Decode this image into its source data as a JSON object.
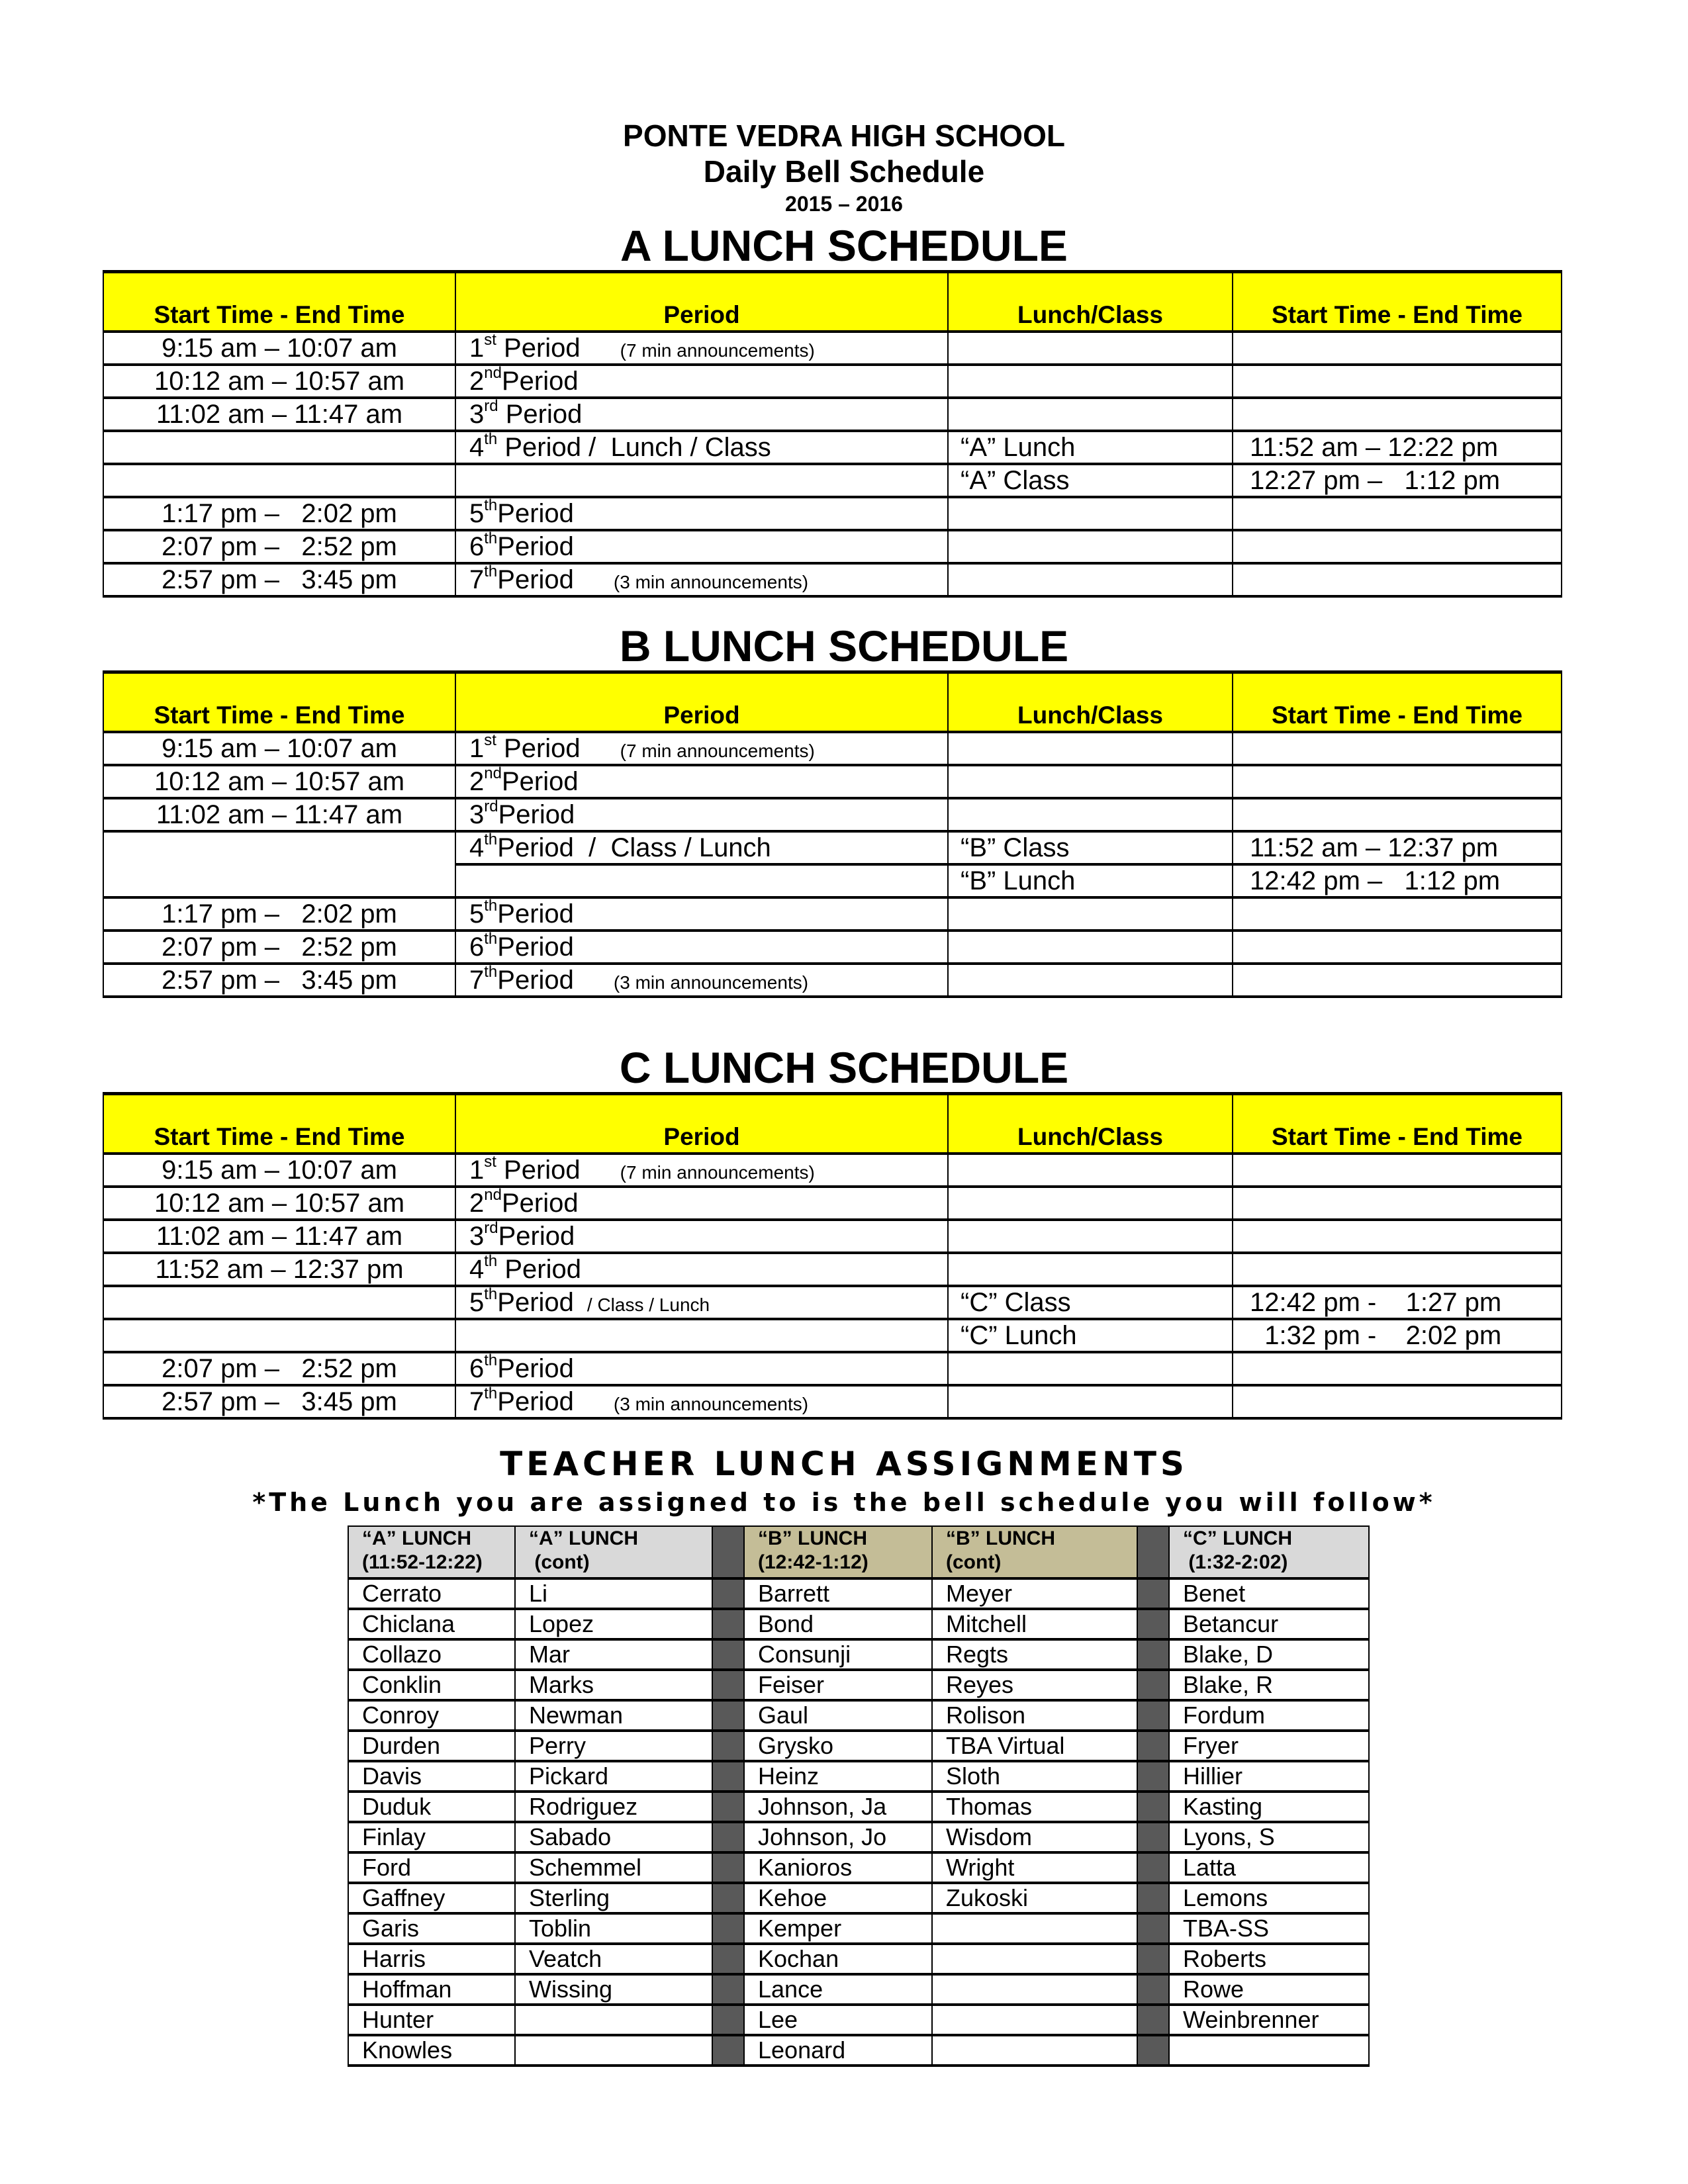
{
  "header": {
    "school": "PONTE VEDRA HIGH SCHOOL",
    "subtitle": "Daily Bell Schedule",
    "year": "2015 – 2016"
  },
  "column_headers": [
    "Start  Time - End Time",
    "Period",
    "Lunch/Class",
    "Start Time - End Time"
  ],
  "schedules": {
    "a": {
      "title": "A LUNCH SCHEDULE",
      "rows": [
        {
          "time": "9:15 am – 10:07 am",
          "num": "1",
          "suf": "st",
          "period": " Period",
          "note": "(7 min announcements)",
          "lc": "",
          "time2": ""
        },
        {
          "time": "10:12 am – 10:57 am",
          "num": "2",
          "suf": "nd",
          "period": "Period",
          "note": "",
          "lc": "",
          "time2": ""
        },
        {
          "time": "11:02 am – 11:47 am",
          "num": "3",
          "suf": "rd",
          "period": " Period",
          "note": "",
          "lc": "",
          "time2": ""
        },
        {
          "time": "",
          "num": "4",
          "suf": "th",
          "period": " Period /  Lunch / Class",
          "note": "",
          "lc": "“A” Lunch",
          "time2": "11:52 am – 12:22 pm"
        },
        {
          "time": "",
          "num": "",
          "suf": "",
          "period": "",
          "note": "",
          "lc": "“A” Class",
          "time2": "12:27 pm –   1:12 pm"
        },
        {
          "time": "1:17 pm –   2:02 pm",
          "num": "5",
          "suf": "th",
          "period": "Period",
          "note": "",
          "lc": "",
          "time2": ""
        },
        {
          "time": "2:07 pm –   2:52 pm",
          "num": "6",
          "suf": "th",
          "period": "Period",
          "note": "",
          "lc": "",
          "time2": ""
        },
        {
          "time": "2:57 pm –   3:45 pm",
          "num": "7",
          "suf": "th",
          "period": "Period",
          "note": "(3 min announcements)",
          "lc": "",
          "time2": ""
        }
      ]
    },
    "b": {
      "title": "B LUNCH SCHEDULE",
      "rows": [
        {
          "time": "9:15 am – 10:07 am",
          "num": "1",
          "suf": "st",
          "period": " Period",
          "note": "(7 min announcements)",
          "lc": "",
          "time2": ""
        },
        {
          "time": "10:12 am – 10:57 am",
          "num": "2",
          "suf": "nd",
          "period": "Period",
          "note": "",
          "lc": "",
          "time2": ""
        },
        {
          "time": "11:02 am – 11:47 am",
          "num": "3",
          "suf": "rd",
          "period": "Period",
          "note": "",
          "lc": "",
          "time2": ""
        },
        {
          "time": "",
          "num": "4",
          "suf": "th",
          "period": "Period  /  Class / Lunch",
          "note": "",
          "lc": "“B” Class",
          "time2": "11:52 am – 12:37 pm"
        },
        {
          "time": "",
          "num": "",
          "suf": "",
          "period": "",
          "note": "",
          "lc": "“B” Lunch",
          "time2": "12:42 pm –   1:12 pm"
        },
        {
          "time": "1:17 pm –   2:02 pm",
          "num": "5",
          "suf": "th",
          "period": "Period",
          "note": "",
          "lc": "",
          "time2": ""
        },
        {
          "time": "2:07 pm –   2:52 pm",
          "num": "6",
          "suf": "th",
          "period": "Period",
          "note": "",
          "lc": "",
          "time2": ""
        },
        {
          "time": "2:57 pm –   3:45 pm",
          "num": "7",
          "suf": "th",
          "period": "Period",
          "note": "(3 min announcements)",
          "lc": "",
          "time2": ""
        }
      ]
    },
    "c": {
      "title": "C LUNCH SCHEDULE",
      "rows": [
        {
          "time": "9:15 am – 10:07 am",
          "num": "1",
          "suf": "st",
          "period": " Period",
          "note": "(7 min announcements)",
          "lc": "",
          "time2": ""
        },
        {
          "time": "10:12 am – 10:57 am",
          "num": "2",
          "suf": "nd",
          "period": "Period",
          "note": "",
          "lc": "",
          "time2": ""
        },
        {
          "time": "11:02 am – 11:47 am",
          "num": "3",
          "suf": "rd",
          "period": "Period",
          "note": "",
          "lc": "",
          "time2": ""
        },
        {
          "time": "11:52 am – 12:37 pm",
          "num": "4",
          "suf": "th",
          "period": " Period",
          "note": "",
          "lc": "",
          "time2": ""
        },
        {
          "time": "",
          "num": "5",
          "suf": "th",
          "period": "Period",
          "note": "/ Class / Lunch",
          "lc": "“C” Class",
          "time2": "12:42 pm -    1:27 pm"
        },
        {
          "time": "",
          "num": "",
          "suf": "",
          "period": "",
          "note": "",
          "lc": "“C” Lunch",
          "time2": "  1:32 pm -    2:02 pm"
        },
        {
          "time": "2:07 pm –   2:52 pm",
          "num": "6",
          "suf": "th",
          "period": "Period",
          "note": "",
          "lc": "",
          "time2": ""
        },
        {
          "time": "2:57 pm –   3:45 pm",
          "num": "7",
          "suf": "th",
          "period": "Period",
          "note": "(3 min announcements)",
          "lc": "",
          "time2": ""
        }
      ]
    }
  },
  "teacher": {
    "title": "TEACHER LUNCH ASSIGNMENTS",
    "subtitle": "*The Lunch you are assigned to is the bell schedule you will follow*",
    "headers": [
      {
        "line1": "“A” LUNCH",
        "line2": "(11:52-12:22)"
      },
      {
        "line1": "“A” LUNCH",
        "line2": " (cont)"
      },
      {
        "line1": "“B” LUNCH",
        "line2": "(12:42-1:12)"
      },
      {
        "line1": "“B” LUNCH",
        "line2": "(cont)"
      },
      {
        "line1": "“C” LUNCH",
        "line2": " (1:32-2:02)"
      }
    ],
    "rows": [
      [
        "Cerrato",
        "Li",
        "Barrett",
        "Meyer",
        "Benet"
      ],
      [
        "Chiclana",
        "Lopez",
        "Bond",
        "Mitchell",
        "Betancur"
      ],
      [
        "Collazo",
        "Mar",
        "Consunji",
        "Regts",
        "Blake, D"
      ],
      [
        "Conklin",
        "Marks",
        "Feiser",
        "Reyes",
        "Blake, R"
      ],
      [
        "Conroy",
        "Newman",
        "Gaul",
        "Rolison",
        "Fordum"
      ],
      [
        "Durden",
        "Perry",
        "Grysko",
        "TBA Virtual",
        "Fryer"
      ],
      [
        "Davis",
        "Pickard",
        "Heinz",
        "Sloth",
        "Hillier"
      ],
      [
        "Duduk",
        "Rodriguez",
        "Johnson, Ja",
        "Thomas",
        "Kasting"
      ],
      [
        "Finlay",
        "Sabado",
        "Johnson, Jo",
        "Wisdom",
        "Lyons, S"
      ],
      [
        "Ford",
        "Schemmel",
        "Kanioros",
        "Wright",
        "Latta"
      ],
      [
        "Gaffney",
        "Sterling",
        "Kehoe",
        "Zukoski",
        "Lemons"
      ],
      [
        "Garis",
        "Toblin",
        "Kemper",
        "",
        "TBA-SS"
      ],
      [
        "Harris",
        "Veatch",
        "Kochan",
        "",
        "Roberts"
      ],
      [
        "Hoffman",
        "Wissing",
        "Lance",
        "",
        "Rowe"
      ],
      [
        "Hunter",
        "",
        "Lee",
        "",
        "Weinbrenner"
      ],
      [
        "Knowles",
        "",
        "Leonard",
        "",
        ""
      ]
    ]
  },
  "colors": {
    "header_yellow": "#ffff00",
    "a_header_gray": "#d9d9d9",
    "b_header_tan": "#c4bd97",
    "separator": "#595959"
  }
}
